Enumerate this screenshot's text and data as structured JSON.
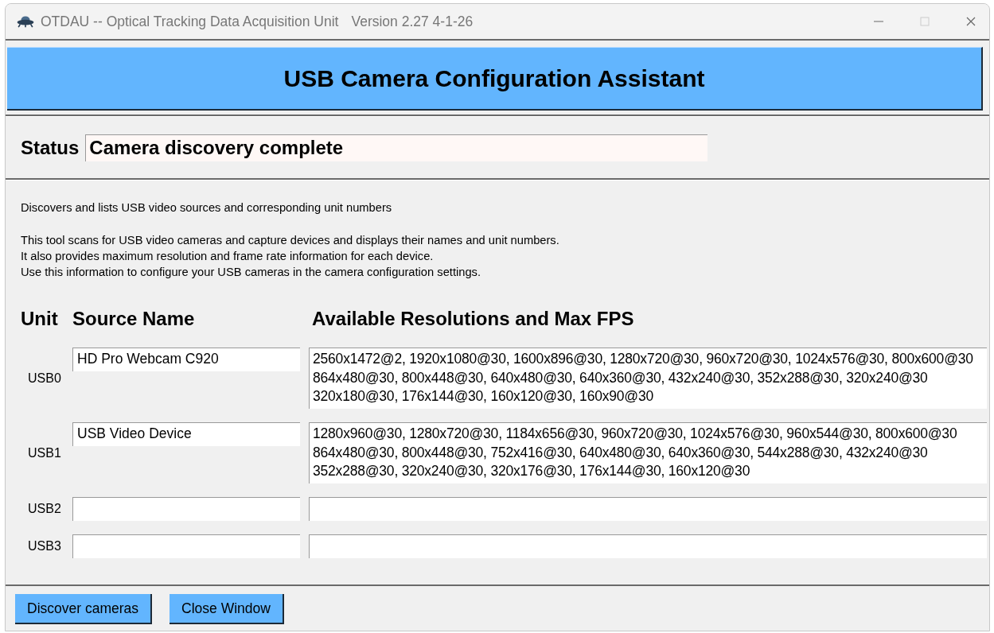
{
  "window": {
    "title": "OTDAU -- Optical Tracking Data Acquisition Unit",
    "version": "Version 2.27 4-1-26"
  },
  "banner": {
    "title": "USB Camera Configuration Assistant"
  },
  "status": {
    "label": "Status",
    "value": "Camera discovery complete"
  },
  "description": {
    "summary": "Discovers and lists USB video sources and corresponding unit numbers",
    "lines": [
      "This tool scans for USB video cameras and capture devices and displays their names and unit numbers.",
      "It also provides maximum resolution and frame rate information for each device.",
      "Use this information to configure your USB cameras in the camera configuration settings."
    ]
  },
  "table": {
    "columns": [
      "Unit",
      "Source Name",
      "Available Resolutions and Max FPS"
    ],
    "rows": [
      {
        "unit": "USB0",
        "source_name": "HD Pro Webcam C920",
        "resolutions": [
          "2560x1472@2, 1920x1080@30, 1600x896@30, 1280x720@30, 960x720@30, 1024x576@30, 800x600@30",
          "864x480@30, 800x448@30, 640x480@30, 640x360@30, 432x240@30, 352x288@30, 320x240@30",
          "320x180@30, 176x144@30, 160x120@30, 160x90@30"
        ]
      },
      {
        "unit": "USB1",
        "source_name": "USB Video Device",
        "resolutions": [
          "1280x960@30, 1280x720@30, 1184x656@30, 960x720@30, 1024x576@30, 960x544@30, 800x600@30",
          "864x480@30, 800x448@30, 752x416@30, 640x480@30, 640x360@30, 544x288@30, 432x240@30",
          "352x288@30, 320x240@30, 320x176@30, 176x144@30, 160x120@30"
        ]
      },
      {
        "unit": "USB2"
      },
      {
        "unit": "USB3"
      }
    ]
  },
  "buttons": [
    "Discover cameras",
    "Close Window"
  ]
}
